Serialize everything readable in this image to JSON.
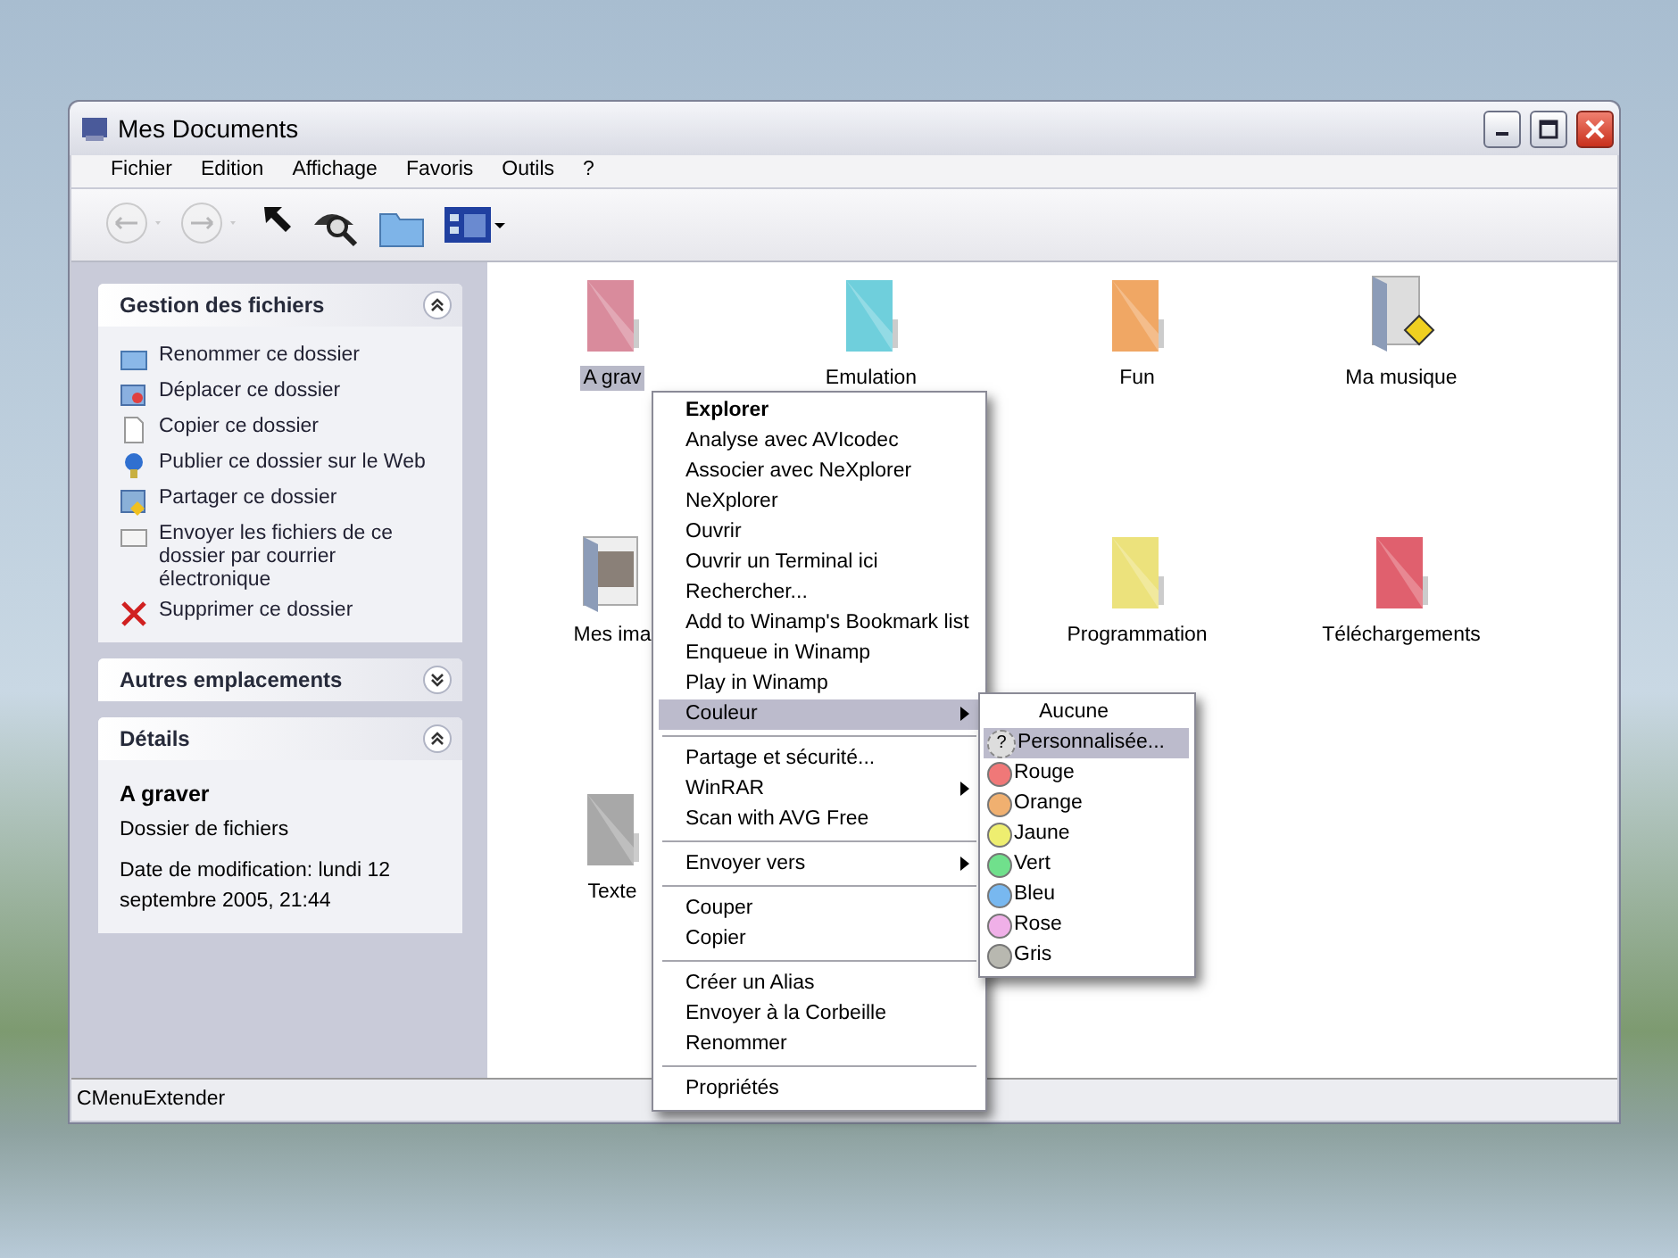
{
  "window": {
    "title": "Mes Documents"
  },
  "menu_bar": [
    "Fichier",
    "Edition",
    "Affichage",
    "Favoris",
    "Outils",
    "?"
  ],
  "toolbar": [
    {
      "kind": "back",
      "disabled": true
    },
    {
      "kind": "forward",
      "disabled": true
    },
    {
      "kind": "up",
      "disabled": false
    },
    {
      "kind": "search",
      "disabled": false
    },
    {
      "kind": "folders",
      "disabled": false
    },
    {
      "kind": "views",
      "disabled": false
    }
  ],
  "task_panels": [
    {
      "title": "Gestion des fichiers",
      "expanded": true,
      "items": [
        {
          "kind": "rename",
          "label": "Renommer ce dossier"
        },
        {
          "kind": "move",
          "label": "Déplacer ce dossier"
        },
        {
          "kind": "copy",
          "label": "Copier ce dossier"
        },
        {
          "kind": "publish",
          "label": "Publier ce dossier sur le Web"
        },
        {
          "kind": "share",
          "label": "Partager ce dossier"
        },
        {
          "kind": "email",
          "label": "Envoyer les fichiers de ce dossier par courrier électronique"
        },
        {
          "kind": "delete",
          "label": "Supprimer ce dossier"
        }
      ]
    },
    {
      "title": "Autres emplacements",
      "expanded": false
    },
    {
      "title": "Détails",
      "expanded": true,
      "details": {
        "name": "A graver",
        "type": "Dossier de fichiers",
        "modified": "Date de modification: lundi 12 septembre 2005, 21:44"
      }
    }
  ],
  "folder_rows": [
    [
      {
        "label": "A grav",
        "kind": "plain",
        "color": "#d98b9c",
        "selected": true
      },
      {
        "label": "Emulation",
        "kind": "plain",
        "color": "#6fcfdc",
        "selected": false
      },
      {
        "label": "Fun",
        "kind": "plain",
        "color": "#f0a764",
        "selected": false
      },
      {
        "label": "Ma musique",
        "kind": "music",
        "color": "#8c9cb8",
        "selected": false
      }
    ],
    [
      {
        "label": "Mes ima",
        "kind": "pictures",
        "color": "#8c9cb8",
        "selected": false
      },
      {
        "label": "Programmation",
        "kind": "plain",
        "color": "#ece27c",
        "selected": false
      },
      {
        "label": "Téléchargements",
        "kind": "plain",
        "color": "#e0606e",
        "selected": false
      }
    ],
    [
      {
        "label": "Texte",
        "kind": "plain",
        "color": "#a8a8a8",
        "selected": false
      }
    ]
  ],
  "context_menu": [
    {
      "kind": "item",
      "label": "Explorer",
      "default": true
    },
    {
      "kind": "item",
      "label": "Analyse avec AVIcodec"
    },
    {
      "kind": "item",
      "label": "Associer avec NeXplorer"
    },
    {
      "kind": "item",
      "label": "NeXplorer"
    },
    {
      "kind": "item",
      "label": "Ouvrir"
    },
    {
      "kind": "item",
      "label": "Ouvrir un Terminal ici"
    },
    {
      "kind": "item",
      "label": "Rechercher..."
    },
    {
      "kind": "item",
      "label": "Add to Winamp's Bookmark list"
    },
    {
      "kind": "item",
      "label": "Enqueue in Winamp"
    },
    {
      "kind": "item",
      "label": "Play in Winamp"
    },
    {
      "kind": "item",
      "label": "Couleur",
      "submenu": true,
      "selected": true
    },
    {
      "kind": "separator"
    },
    {
      "kind": "item",
      "label": "Partage et sécurité..."
    },
    {
      "kind": "item",
      "label": "WinRAR",
      "submenu": true
    },
    {
      "kind": "item",
      "label": "Scan with AVG Free"
    },
    {
      "kind": "separator"
    },
    {
      "kind": "item",
      "label": "Envoyer vers",
      "submenu": true
    },
    {
      "kind": "separator"
    },
    {
      "kind": "item",
      "label": "Couper"
    },
    {
      "kind": "item",
      "label": "Copier"
    },
    {
      "kind": "separator"
    },
    {
      "kind": "item",
      "label": "Créer un Alias"
    },
    {
      "kind": "item",
      "label": "Envoyer à la Corbeille"
    },
    {
      "kind": "item",
      "label": "Renommer"
    },
    {
      "kind": "separator"
    },
    {
      "kind": "item",
      "label": "Propriétés"
    }
  ],
  "color_submenu": [
    {
      "kind": "none",
      "label": "Aucune",
      "selected": false
    },
    {
      "kind": "custom",
      "icon_text": "?",
      "label": "Personnalisée...",
      "selected": true
    },
    {
      "kind": "color",
      "label": "Rouge",
      "color": "#f07878",
      "selected": false
    },
    {
      "kind": "color",
      "label": "Orange",
      "color": "#f0b070",
      "selected": false
    },
    {
      "kind": "color",
      "label": "Jaune",
      "color": "#eeee70",
      "selected": false
    },
    {
      "kind": "color",
      "label": "Vert",
      "color": "#70e08c",
      "selected": false
    },
    {
      "kind": "color",
      "label": "Bleu",
      "color": "#78b8f0",
      "selected": false
    },
    {
      "kind": "color",
      "label": "Rose",
      "color": "#f0b0e8",
      "selected": false
    },
    {
      "kind": "color",
      "label": "Gris",
      "color": "#b8b8b0",
      "selected": false
    }
  ],
  "status_bar": "CMenuExtender"
}
